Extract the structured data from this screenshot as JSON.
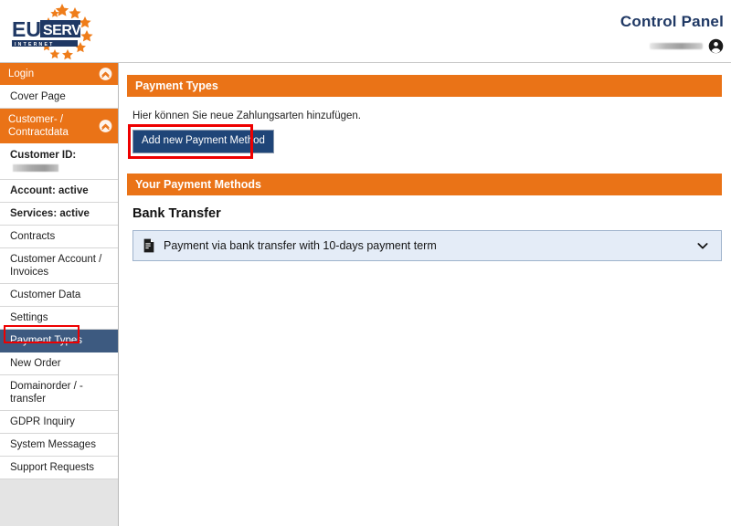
{
  "header": {
    "logo_main": "EU",
    "logo_sub": "SERV",
    "logo_tagline": "I N T E R N E T",
    "title": "Control Panel",
    "user_name_redacted": "",
    "user_icon": "account-circle-icon"
  },
  "sidebar": {
    "items": [
      {
        "label": "Login",
        "type": "group",
        "icon": "collapse-circle-icon"
      },
      {
        "label": "Cover Page",
        "type": "item"
      },
      {
        "label": "Customer- / Contractdata",
        "type": "group",
        "icon": "collapse-circle-icon"
      },
      {
        "label": "Customer ID:",
        "type": "item",
        "bold": true,
        "redacted": true
      },
      {
        "label": "Account: active",
        "type": "item",
        "bold": true
      },
      {
        "label": "Services: active",
        "type": "item",
        "bold": true
      },
      {
        "label": "Contracts",
        "type": "item"
      },
      {
        "label": "Customer Account / Invoices",
        "type": "item"
      },
      {
        "label": "Customer Data",
        "type": "item"
      },
      {
        "label": "Settings",
        "type": "item"
      },
      {
        "label": "Payment Types",
        "type": "item",
        "active": true,
        "annotated": true
      },
      {
        "label": "New Order",
        "type": "item"
      },
      {
        "label": "Domainorder / -transfer",
        "type": "item"
      },
      {
        "label": "GDPR Inquiry",
        "type": "item"
      },
      {
        "label": "System Messages",
        "type": "item"
      },
      {
        "label": "Support Requests",
        "type": "item"
      }
    ]
  },
  "main": {
    "panel_title": "Payment Types",
    "hint": "Hier können Sie neue Zahlungsarten hinzufügen.",
    "add_button_label": "Add new Payment Method",
    "methods_panel_title": "Your Payment Methods",
    "method_group_title": "Bank Transfer",
    "payment_method": {
      "icon": "invoice-document-icon",
      "label": "Payment via bank transfer with 10-days payment term",
      "expand_icon": "chevron-down-icon"
    }
  },
  "colors": {
    "orange": "#ea7317",
    "navy_button": "#1f4578",
    "active_nav": "#3d5a80",
    "title_blue": "#1f3864",
    "annotation_red": "#ee0000",
    "row_bg": "#e4ecf7"
  }
}
